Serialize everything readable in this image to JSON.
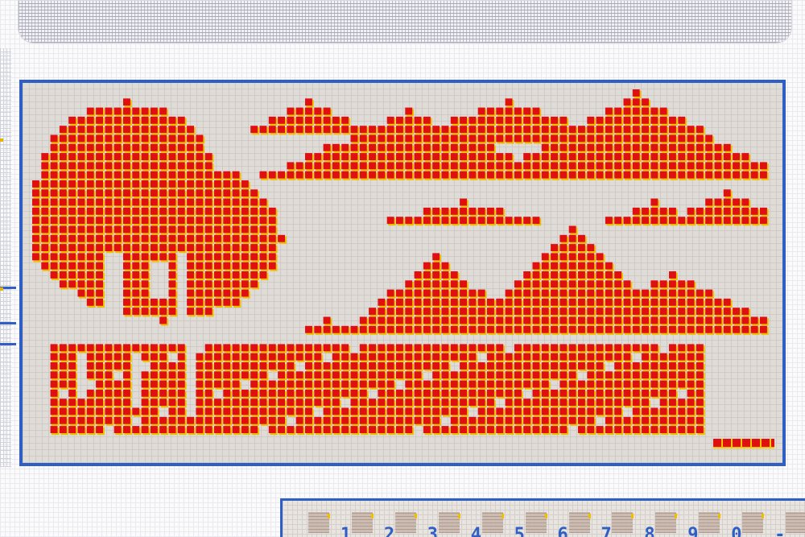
{
  "colors": {
    "frame": "#2f5fc4",
    "pixel_red": "#e01010",
    "pixel_shadow": "#f0c000",
    "panel_bg": "#dfdcd8"
  },
  "keypad": {
    "keys": [
      ".",
      "1",
      "2",
      "3",
      "4",
      "5",
      "6",
      "7",
      "8",
      "9",
      "0",
      "-"
    ]
  }
}
